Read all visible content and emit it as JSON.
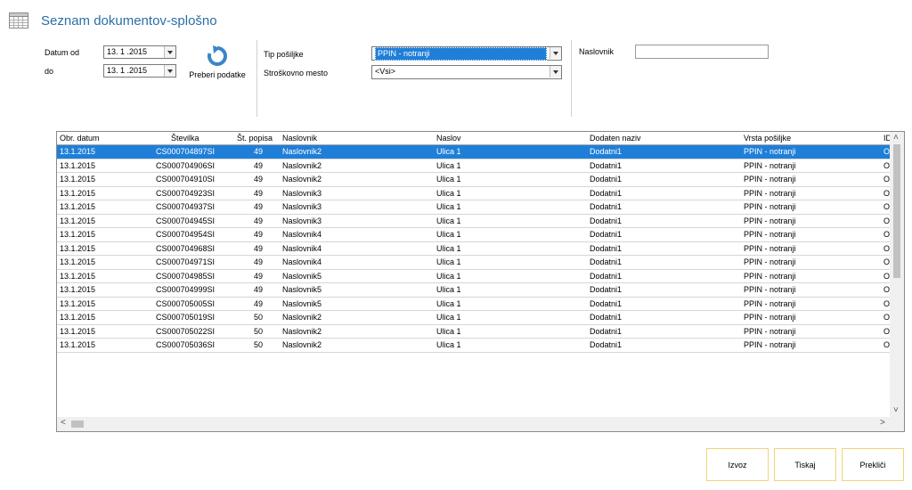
{
  "window": {
    "title": "Seznam dokumentov-splošno"
  },
  "filters": {
    "datum_od_label": "Datum od",
    "datum_od_value": "13. 1 .2015",
    "do_label": "do",
    "do_value": "13. 1 .2015",
    "refresh_label": "Preberi podatke",
    "tip_label": "Tip pošiljke",
    "tip_value": "PPIN - notranji",
    "mesto_label": "Stroškovno mesto",
    "mesto_value": "<Vsi>",
    "naslovnik_label": "Naslovnik",
    "naslovnik_value": ""
  },
  "table": {
    "columns": [
      "Obr. datum",
      "Številka",
      "Št. popisa",
      "Naslovnik",
      "Naslov",
      "Dodaten naziv",
      "Vrsta pošiljke",
      "ID"
    ],
    "rows": [
      [
        "13.1.2015",
        "CS000704897SI",
        "49",
        "Naslovnik2",
        "Ulica 1",
        "Dodatni1",
        "PPIN - notranji",
        "O"
      ],
      [
        "13.1.2015",
        "CS000704906SI",
        "49",
        "Naslovnik2",
        "Ulica 1",
        "Dodatni1",
        "PPIN - notranji",
        "O"
      ],
      [
        "13.1.2015",
        "CS000704910SI",
        "49",
        "Naslovnik2",
        "Ulica 1",
        "Dodatni1",
        "PPIN - notranji",
        "O"
      ],
      [
        "13.1.2015",
        "CS000704923SI",
        "49",
        "Naslovnik3",
        "Ulica 1",
        "Dodatni1",
        "PPIN - notranji",
        "O"
      ],
      [
        "13.1.2015",
        "CS000704937SI",
        "49",
        "Naslovnik3",
        "Ulica 1",
        "Dodatni1",
        "PPIN - notranji",
        "O"
      ],
      [
        "13.1.2015",
        "CS000704945SI",
        "49",
        "Naslovnik3",
        "Ulica 1",
        "Dodatni1",
        "PPIN - notranji",
        "O"
      ],
      [
        "13.1.2015",
        "CS000704954SI",
        "49",
        "Naslovnik4",
        "Ulica 1",
        "Dodatni1",
        "PPIN - notranji",
        "O"
      ],
      [
        "13.1.2015",
        "CS000704968SI",
        "49",
        "Naslovnik4",
        "Ulica 1",
        "Dodatni1",
        "PPIN - notranji",
        "O"
      ],
      [
        "13.1.2015",
        "CS000704971SI",
        "49",
        "Naslovnik4",
        "Ulica 1",
        "Dodatni1",
        "PPIN - notranji",
        "O"
      ],
      [
        "13.1.2015",
        "CS000704985SI",
        "49",
        "Naslovnik5",
        "Ulica 1",
        "Dodatni1",
        "PPIN - notranji",
        "O"
      ],
      [
        "13.1.2015",
        "CS000704999SI",
        "49",
        "Naslovnik5",
        "Ulica 1",
        "Dodatni1",
        "PPIN - notranji",
        "O"
      ],
      [
        "13.1.2015",
        "CS000705005SI",
        "49",
        "Naslovnik5",
        "Ulica 1",
        "Dodatni1",
        "PPIN - notranji",
        "O"
      ],
      [
        "13.1.2015",
        "CS000705019SI",
        "50",
        "Naslovnik2",
        "Ulica 1",
        "Dodatni1",
        "PPIN - notranji",
        "O"
      ],
      [
        "13.1.2015",
        "CS000705022SI",
        "50",
        "Naslovnik2",
        "Ulica 1",
        "Dodatni1",
        "PPIN - notranji",
        "O"
      ],
      [
        "13.1.2015",
        "CS000705036SI",
        "50",
        "Naslovnik2",
        "Ulica 1",
        "Dodatni1",
        "PPIN - notranji",
        "O"
      ]
    ],
    "selected_row": 0
  },
  "buttons": {
    "izvoz": "Izvoz",
    "tiskaj": "Tiskaj",
    "preklici": "Prekliči"
  },
  "icons": {
    "window": "calendar-grid-icon",
    "refresh": "refresh-icon"
  },
  "colors": {
    "title": "#2a6fa6",
    "selection": "#1f7fd8",
    "button_border": "#f2d37a",
    "refresh_icon": "#3a86c8"
  }
}
